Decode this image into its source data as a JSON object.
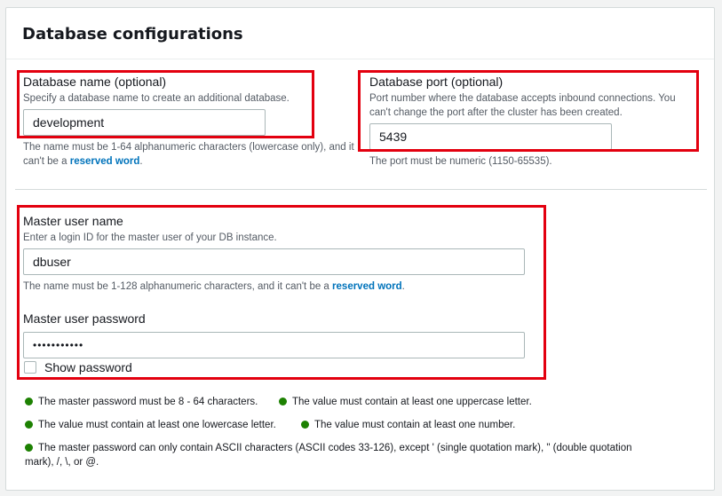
{
  "section": {
    "title": "Database configurations"
  },
  "db_name": {
    "label": "Database name (optional)",
    "description": "Specify a database name to create an additional database.",
    "value": "development",
    "constraint_text": "The name must be 1-64 alphanumeric characters (lowercase only), and it can't be a",
    "constraint_link": "reserved word",
    "constraint_end": "."
  },
  "db_port": {
    "label": "Database port (optional)",
    "description_line1": "Port number where the database accepts inbound connections. You",
    "description_line2": "can't change the port after the cluster has been created.",
    "value": "5439",
    "constraint_text": "The port must be numeric (1150-65535)."
  },
  "master_user": {
    "label": "Master user name",
    "description": "Enter a login ID for the master user of your DB instance.",
    "value": "dbuser",
    "constraint_text": "The name must be 1-128 alphanumeric characters, and it can't be a",
    "constraint_link": "reserved word",
    "constraint_end": "."
  },
  "master_password": {
    "label": "Master user password",
    "value": "•••••••••••",
    "show_password_label": "Show password"
  },
  "requirements": [
    "The master password must be 8 - 64 characters.",
    "The value must contain at least one uppercase letter.",
    "The value must contain at least one lowercase letter.",
    "The value must contain at least one number.",
    "The master password can only contain ASCII characters (ASCII codes 33-126), except ' (single quotation mark), \" (double quotation",
    "mark), /, \\, or @."
  ],
  "colors": {
    "highlight": "#e3000f",
    "link": "#0073bb",
    "status_ok": "#1d8102"
  }
}
